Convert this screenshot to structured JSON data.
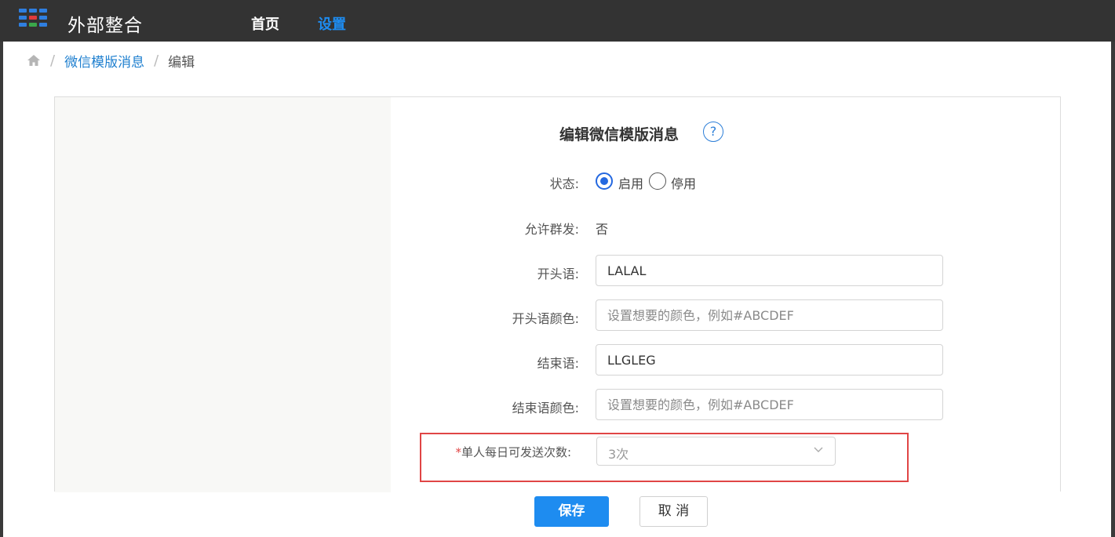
{
  "app": {
    "title": "外部整合",
    "logo_icon": "grid-logo-icon"
  },
  "nav": {
    "items": [
      {
        "label": "首页",
        "active": false
      },
      {
        "label": "设置",
        "active": true
      }
    ]
  },
  "breadcrumb": {
    "home_icon": "home-icon",
    "link": "微信模版消息",
    "current": "编辑"
  },
  "form": {
    "title": "编辑微信模版消息",
    "help_symbol": "?",
    "status": {
      "label": "状态:",
      "options": [
        {
          "label": "启用",
          "checked": true
        },
        {
          "label": "停用",
          "checked": false
        }
      ]
    },
    "allow_group": {
      "label": "允许群发:",
      "value": "否"
    },
    "opening": {
      "label": "开头语:",
      "value": "LALAL"
    },
    "opening_color": {
      "label": "开头语颜色:",
      "placeholder": "设置想要的颜色，例如#ABCDEF"
    },
    "ending": {
      "label": "结束语:",
      "value": "LLGLEG"
    },
    "ending_color": {
      "label": "结束语颜色:",
      "placeholder": "设置想要的颜色，例如#ABCDEF"
    },
    "daily_limit": {
      "required_mark": "*",
      "label": "单人每日可发送次数:",
      "value": "3次"
    }
  },
  "actions": {
    "save": "保存",
    "cancel": "取 消"
  },
  "colors": {
    "topbar": "#333333",
    "accent": "#1e8cf0",
    "highlight": "#e04545"
  }
}
